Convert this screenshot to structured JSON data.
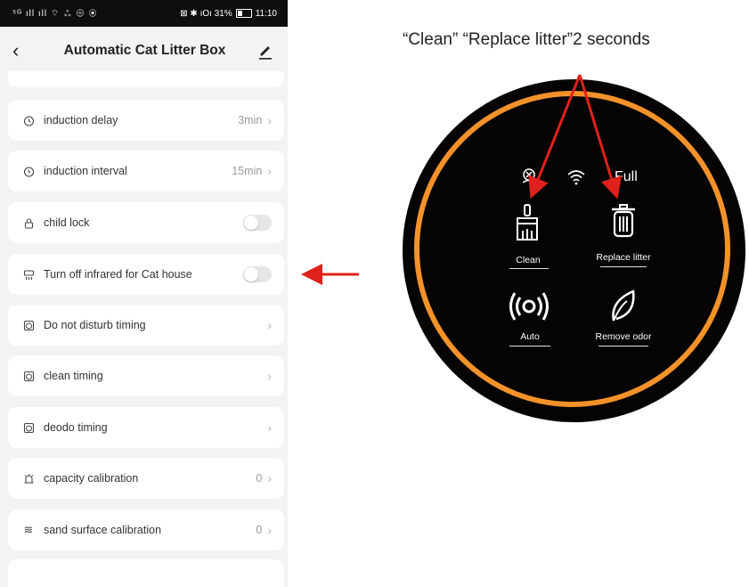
{
  "status_bar": {
    "left": "⁵ᴳ ıll ıll ⌔ ⁂ ⊕ ◉",
    "right": "⊠ ✱ ıOı 31%",
    "time": "11:10"
  },
  "nav": {
    "title": "Automatic Cat Litter Box"
  },
  "settings": [
    {
      "label": "induction delay",
      "value": "3min",
      "icon": "timer-icon"
    },
    {
      "label": "induction interval",
      "value": "15min",
      "icon": "timer-icon"
    },
    {
      "label": "child lock",
      "toggle": false,
      "icon": "lock-icon"
    },
    {
      "label": "Turn off infrared for Cat house",
      "toggle": false,
      "icon": "infrared-icon"
    },
    {
      "label": "Do not disturb timing",
      "icon": "alarm-icon"
    },
    {
      "label": "clean timing",
      "icon": "alarm-icon"
    },
    {
      "label": "deodo timing",
      "icon": "alarm-icon"
    },
    {
      "label": "capacity calibration",
      "value": "0",
      "icon": "bell-icon"
    },
    {
      "label": "sand surface calibration",
      "value": "0",
      "icon": "waves-icon"
    }
  ],
  "annotation": "“Clean” “Replace litter”2 seconds",
  "device": {
    "status_full": "Full",
    "buttons": {
      "clean": "Clean",
      "replace": "Replace litter",
      "auto": "Auto",
      "remove_odor": "Remove odor"
    }
  },
  "colors": {
    "ring": "#f4922a",
    "arrow": "#e0211b"
  }
}
